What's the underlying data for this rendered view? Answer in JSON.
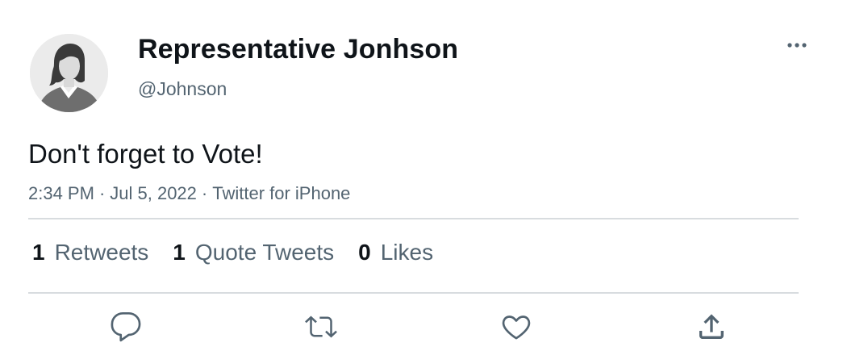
{
  "tweet": {
    "display_name": "Representative Jonhson",
    "handle": "@Johnson",
    "text": "Don't forget to Vote!",
    "time": "2:34 PM",
    "date": "Jul 5, 2022",
    "source": "Twitter for iPhone",
    "separator": "·"
  },
  "stats": {
    "retweets": {
      "count": "1",
      "label": "Retweets"
    },
    "quote_tweets": {
      "count": "1",
      "label": "Quote Tweets"
    },
    "likes": {
      "count": "0",
      "label": "Likes"
    }
  },
  "icons": {
    "avatar": "default-avatar-icon",
    "more": "more-options-icon",
    "reply": "reply-icon",
    "retweet": "retweet-icon",
    "like": "heart-icon",
    "share": "share-icon"
  },
  "colors": {
    "text_primary": "#0f1419",
    "text_secondary": "#536471",
    "divider": "#d8dcdf",
    "icon": "#536471"
  }
}
